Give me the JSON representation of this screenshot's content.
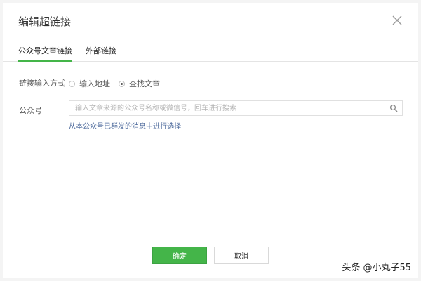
{
  "dialog": {
    "title": "编辑超链接",
    "close_icon": "close-icon"
  },
  "tabs": [
    {
      "label": "公众号文章链接",
      "active": true
    },
    {
      "label": "外部链接",
      "active": false
    }
  ],
  "link_input_method": {
    "label": "链接输入方式",
    "options": [
      {
        "label": "输入地址",
        "checked": false
      },
      {
        "label": "查找文章",
        "checked": true
      }
    ]
  },
  "account": {
    "label": "公众号",
    "search_placeholder": "输入文章来源的公众号名称或微信号，回车进行搜索",
    "search_value": "",
    "search_icon": "search-icon",
    "hint_link": "从本公众号已群发的消息中进行选择"
  },
  "buttons": {
    "confirm": "确定",
    "cancel": "取消"
  },
  "watermark": "头条 @小丸子55",
  "colors": {
    "accent": "#44b549",
    "link": "#4d6a9c"
  }
}
